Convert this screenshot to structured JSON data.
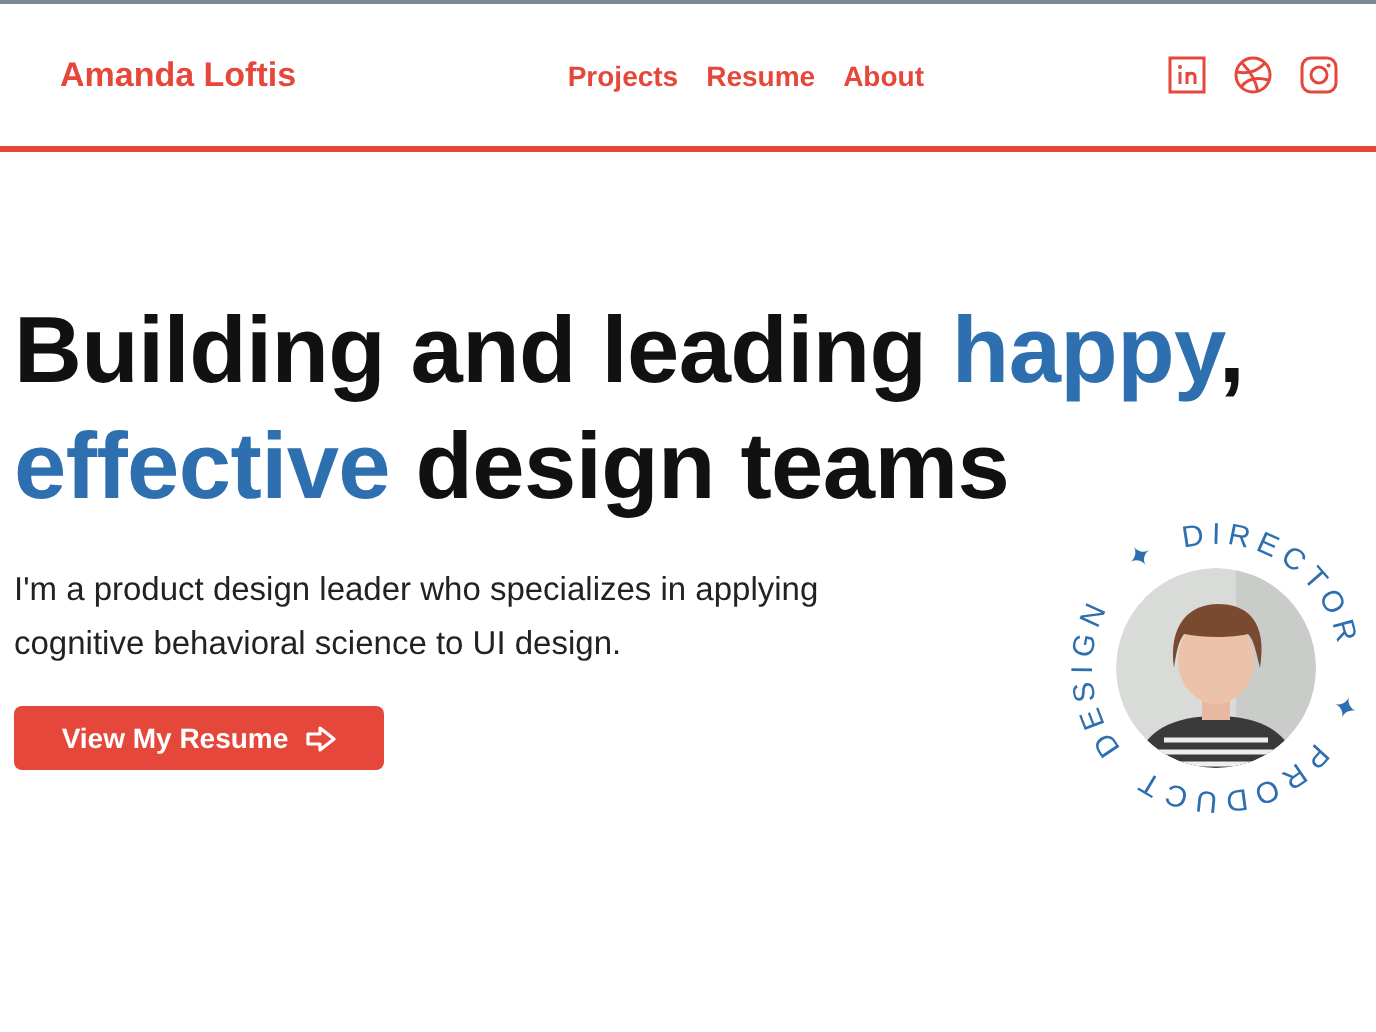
{
  "header": {
    "brand": "Amanda Loftis",
    "nav": [
      {
        "label": "Projects"
      },
      {
        "label": "Resume"
      },
      {
        "label": "About"
      }
    ],
    "social": [
      {
        "kind": "linkedin"
      },
      {
        "kind": "dribbble"
      },
      {
        "kind": "instagram"
      }
    ]
  },
  "hero": {
    "headline": [
      {
        "text": "Building and leading ",
        "accent": false
      },
      {
        "text": "happy",
        "accent": true
      },
      {
        "text": ", ",
        "accent": false
      },
      {
        "text": "effective",
        "accent": true
      },
      {
        "text": " design teams",
        "accent": false
      }
    ],
    "intro": "I'm a product design leader who specializes in applying cognitive behavioral science to UI design.",
    "button": "View My Resume",
    "badge": {
      "ring": [
        "DIRECTOR",
        "✦",
        "PRODUCT",
        "DESIGN",
        "✦"
      ]
    }
  }
}
